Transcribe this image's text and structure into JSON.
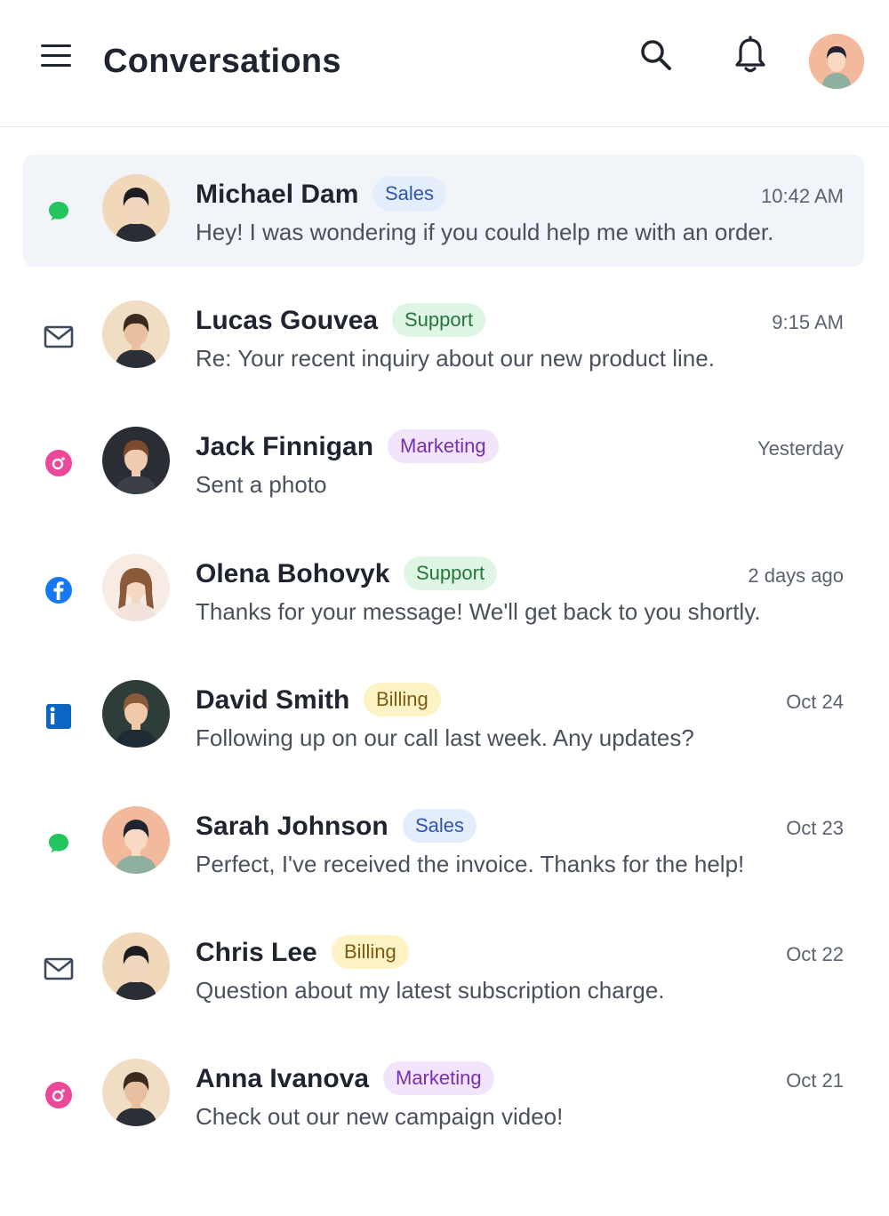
{
  "header": {
    "title": "Conversations",
    "icons": {
      "menu": "menu-icon",
      "search": "search-icon",
      "notifications": "bell-icon",
      "profile": "user-avatar"
    }
  },
  "colors": {
    "whatsapp": "#22c55e",
    "email": "#3d4a5c",
    "instagram": "#ec4899",
    "facebook": "#1877f2",
    "linkedin": "#0a66c2",
    "active_row": "#f1f4f8"
  },
  "conversations": [
    {
      "name": "Michael Dam",
      "tag": "Sales",
      "time": "10:42 AM",
      "preview": "Hey! I was wondering if you could help me with an order.",
      "channel": "whatsapp-icon",
      "active": true
    },
    {
      "name": "Lucas Gouvea",
      "tag": "Support",
      "time": "9:15 AM",
      "preview": "Re: Your recent inquiry about our new product line.",
      "channel": "mail-icon",
      "active": false
    },
    {
      "name": "Jack Finnigan",
      "tag": "Marketing",
      "time": "Yesterday",
      "preview": "Sent a photo",
      "channel": "instagram-icon",
      "active": false
    },
    {
      "name": "Olena Bohovyk",
      "tag": "Support",
      "time": "2 days ago",
      "preview": "Thanks for your message! We'll get back to you shortly.",
      "channel": "facebook-icon",
      "active": false
    },
    {
      "name": "David Smith",
      "tag": "Billing",
      "time": "Oct 24",
      "preview": "Following up on our call last week. Any updates?",
      "channel": "linkedin-icon",
      "active": false
    },
    {
      "name": "Sarah Johnson",
      "tag": "Sales",
      "time": "Oct 23",
      "preview": "Perfect, I've received the invoice. Thanks for the help!",
      "channel": "whatsapp-icon",
      "active": false
    },
    {
      "name": "Chris Lee",
      "tag": "Billing",
      "time": "Oct 22",
      "preview": "Question about my latest subscription charge.",
      "channel": "mail-icon",
      "active": false
    },
    {
      "name": "Anna Ivanova",
      "tag": "Marketing",
      "time": "Oct 21",
      "preview": "Check out our new campaign video!",
      "channel": "instagram-icon",
      "active": false
    }
  ]
}
